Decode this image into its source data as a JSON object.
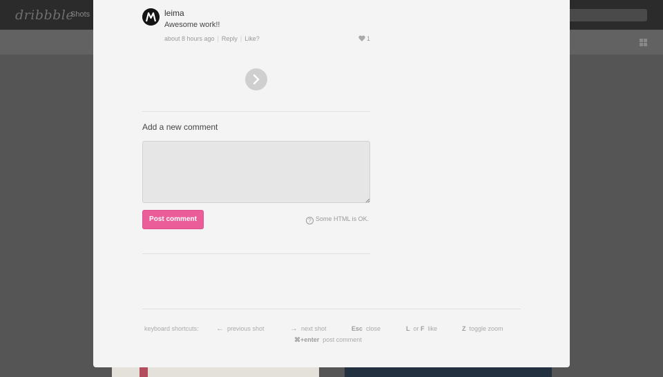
{
  "background": {
    "logo": "dribbble",
    "nav_shots": "Shots"
  },
  "comment": {
    "author": "leima",
    "text": "Awesome work!!",
    "time": "about 8 hours ago",
    "reply_label": "Reply",
    "like_label": "Like?",
    "likes_count": "1"
  },
  "form": {
    "title": "Add a new comment",
    "textarea_value": "",
    "post_label": "Post comment",
    "html_note": "Some HTML is OK."
  },
  "shortcuts": {
    "label": "keyboard shortcuts:",
    "prev_key": "←",
    "prev_label": "previous shot",
    "next_key": "→",
    "next_label": "next shot",
    "esc_key": "Esc",
    "esc_label": "close",
    "like_key_l": "L",
    "like_or": "or",
    "like_key_f": "F",
    "like_label": "like",
    "zoom_key": "Z",
    "zoom_label": "toggle zoom",
    "post_key": "⌘+enter",
    "post_label": "post comment"
  },
  "colors": {
    "accent_pink": "#ea5d99",
    "modal_bg": "#f4f4f4",
    "overlay": "#555555"
  }
}
